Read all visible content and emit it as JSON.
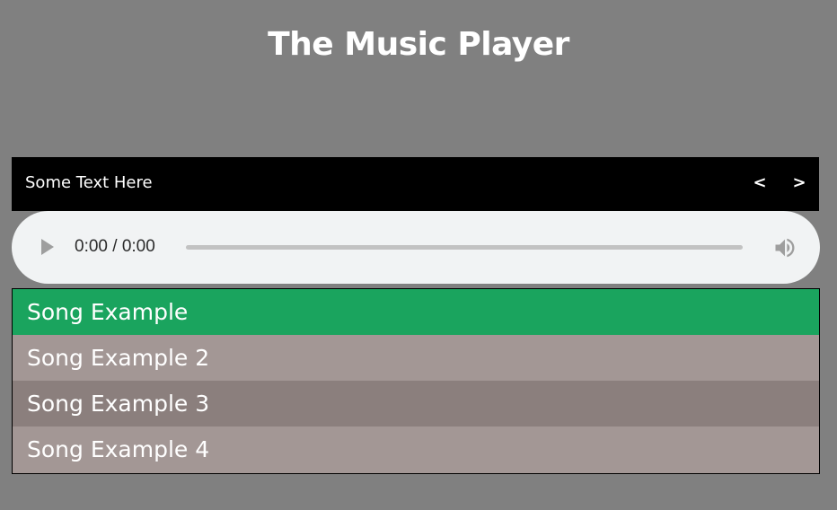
{
  "page": {
    "title": "The Music Player"
  },
  "header": {
    "text": "Some Text Here",
    "prev_label": "<",
    "next_label": ">"
  },
  "audio": {
    "time": "0:00 / 0:00",
    "progress": 0,
    "play_icon": "play-icon",
    "volume_icon": "volume-icon"
  },
  "playlist": {
    "items": [
      {
        "label": "Song Example",
        "active": true
      },
      {
        "label": "Song Example 2",
        "active": false
      },
      {
        "label": "Song Example 3",
        "active": false
      },
      {
        "label": "Song Example 4",
        "active": false
      }
    ]
  },
  "colors": {
    "background": "#808080",
    "active_item": "#1aa45e",
    "item_light": "#a39795",
    "item_dark": "#8b7f7d",
    "header_bar": "#000000",
    "audio_bg": "#f1f3f4"
  }
}
